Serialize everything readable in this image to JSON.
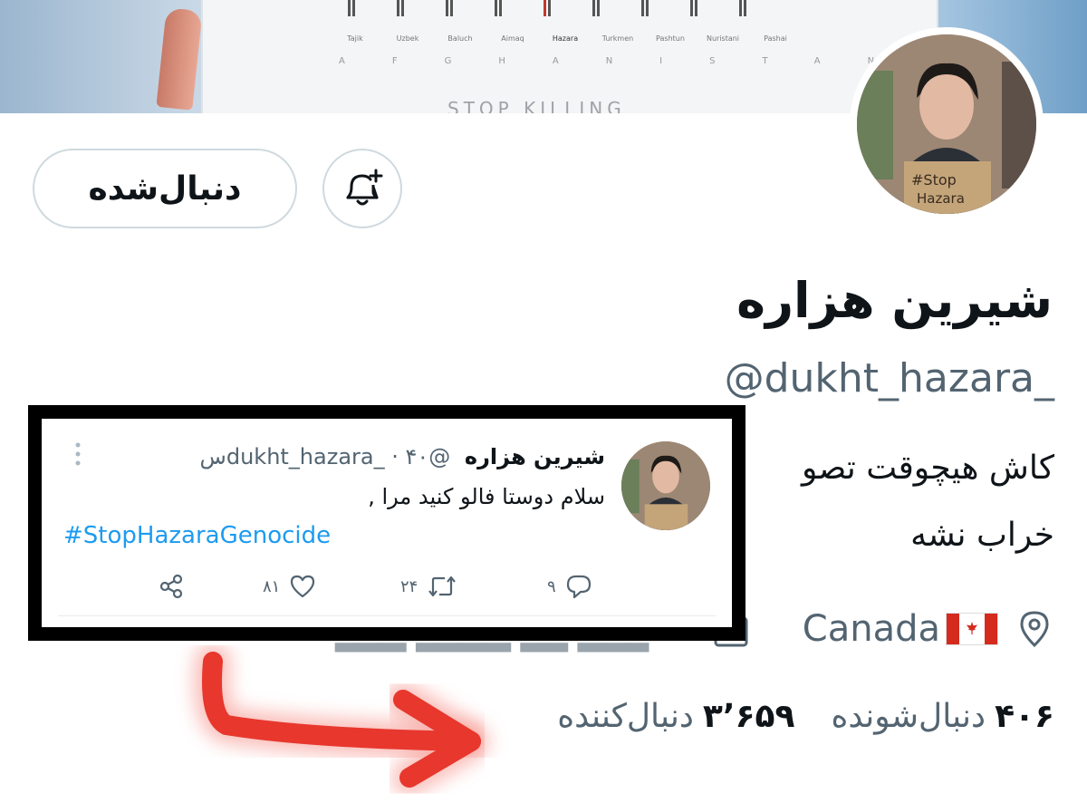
{
  "banner": {
    "labels": [
      "Tajik",
      "Uzbek",
      "Baluch",
      "Aimaq",
      "Hazara",
      "Turkmen",
      "Pashtun",
      "Nuristani",
      "Pashai"
    ],
    "country_letters": "AFGHANISTAN",
    "stop_text": "STOP KILLING"
  },
  "profile": {
    "name": "شیرین هزاره",
    "handle": "@dukht_hazara_",
    "bio_line1": "کاش هیچوقت تصو",
    "bio_line2": "خراب نشه",
    "location": "Canada",
    "following_count": "۴۰۶",
    "following_label": "دنبال‌شونده",
    "followers_count": "۳٬۶۵۹",
    "followers_label": "دنبال‌کننده"
  },
  "actions": {
    "follow_label": "دنبال‌شده"
  },
  "tweet": {
    "name": "شیرین هزاره",
    "handle": "@dukht_hazara_",
    "time": "۴۰س",
    "text": "سلام دوستا فالو کنید مرا ,",
    "hashtag": "#StopHazaraGenocide",
    "reply_count": "۹",
    "retweet_count": "۲۴",
    "like_count": "۸۱"
  },
  "colors": {
    "accent": "#1d9bf0",
    "annotation_arrow": "#e8372d",
    "frame": "#000000"
  }
}
